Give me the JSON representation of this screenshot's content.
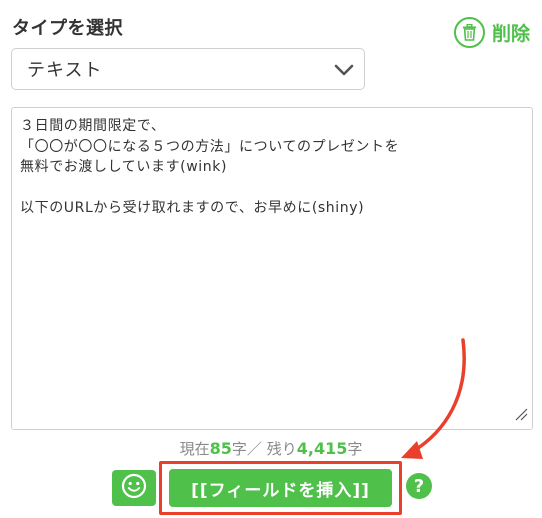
{
  "type_selector": {
    "label": "タイプを選択",
    "selected_value": "テキスト",
    "chevron_icon": "chevron-down-icon"
  },
  "delete_button": {
    "label": "削除",
    "icon": "trash-icon"
  },
  "message": {
    "lines": [
      "３日間の期間限定で、",
      "「〇〇が〇〇になる５つの方法」についてのプレゼントを",
      "無料でお渡ししています(wink)",
      "",
      "以下のURLから受け取れますので、お早めに(shiny)"
    ]
  },
  "counter": {
    "current_prefix": "現在",
    "current_count": "85",
    "current_suffix": "字",
    "separator": "／",
    "remaining_prefix": "残り",
    "remaining_count": "4,415",
    "remaining_suffix": "字"
  },
  "actions": {
    "emoji_icon": "smiley-icon",
    "insert_field_label": "[[フィールドを挿入]]",
    "help_label": "?"
  },
  "colors": {
    "accent": "#4fc04a",
    "annotation": "#e8402a",
    "text": "#333333",
    "muted": "#8a8a8a"
  }
}
